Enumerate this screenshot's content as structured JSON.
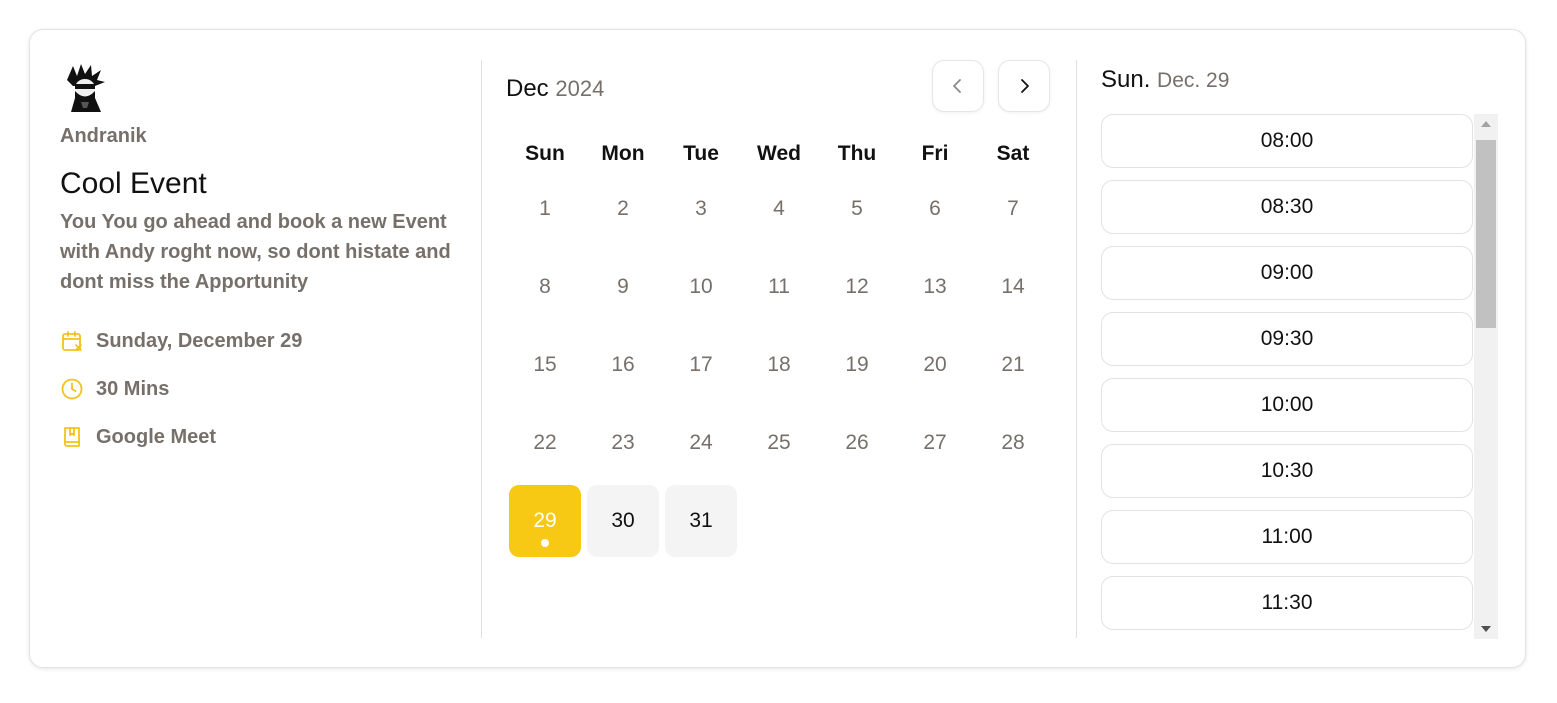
{
  "host": {
    "name": "Andranik",
    "avatar_icon": "ninja-avatar-icon"
  },
  "event": {
    "title": "Cool Event",
    "description": "You You go ahead and book a new Event with Andy roght now, so dont histate and dont miss the Apportunity",
    "date": "Sunday, December 29",
    "duration": "30 Mins",
    "location": "Google Meet",
    "icons": [
      "calendar-icon",
      "clock-icon",
      "book-icon"
    ]
  },
  "calendar": {
    "month": "Dec",
    "year": "2024",
    "weekdays": [
      "Sun",
      "Mon",
      "Tue",
      "Wed",
      "Thu",
      "Fri",
      "Sat"
    ],
    "days": [
      "1",
      "2",
      "3",
      "4",
      "5",
      "6",
      "7",
      "8",
      "9",
      "10",
      "11",
      "12",
      "13",
      "14",
      "15",
      "16",
      "17",
      "18",
      "19",
      "20",
      "21",
      "22",
      "23",
      "24",
      "25",
      "26",
      "27",
      "28",
      "29",
      "30",
      "31"
    ],
    "selected_day": "29",
    "available_days": [
      "29",
      "30",
      "31"
    ]
  },
  "timeslots": {
    "weekday": "Sun.",
    "date": "Dec. 29",
    "slots": [
      "08:00",
      "08:30",
      "09:00",
      "09:30",
      "10:00",
      "10:30",
      "11:00",
      "11:30"
    ]
  },
  "colors": {
    "accent": "#f7c915",
    "muted_text": "#77706a",
    "text": "#111111",
    "border": "#e2e2e2"
  }
}
